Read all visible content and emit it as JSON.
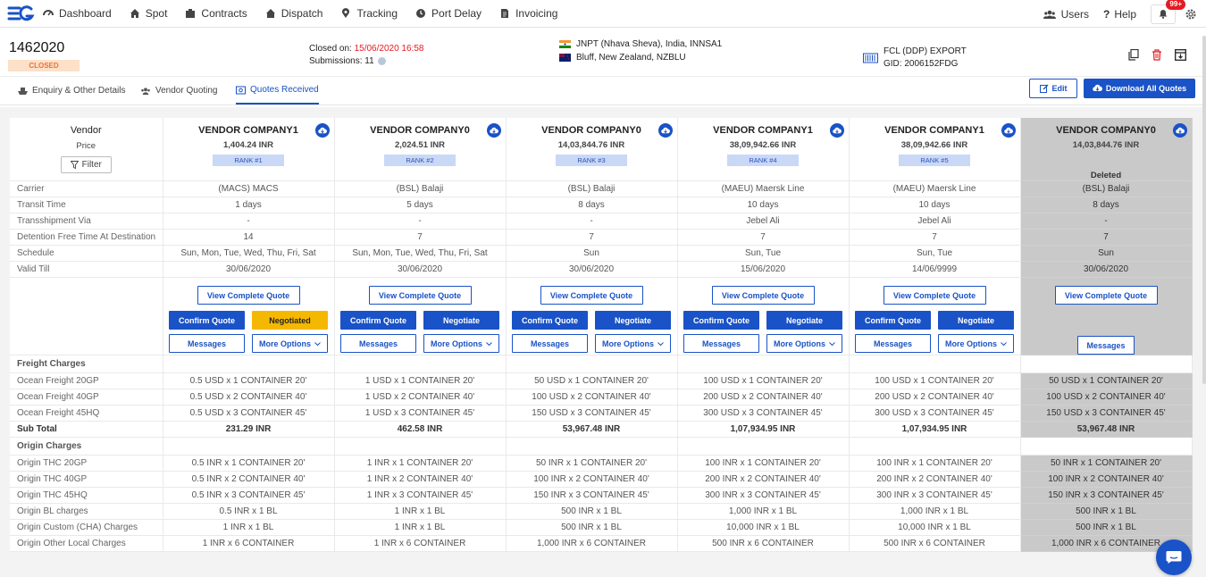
{
  "nav": {
    "items": [
      {
        "label": "Dashboard",
        "icon": "dashboard-icon"
      },
      {
        "label": "Spot",
        "icon": "spot-icon"
      },
      {
        "label": "Contracts",
        "icon": "contracts-icon"
      },
      {
        "label": "Dispatch",
        "icon": "dispatch-icon"
      },
      {
        "label": "Tracking",
        "icon": "tracking-icon"
      },
      {
        "label": "Port Delay",
        "icon": "clock-icon"
      },
      {
        "label": "Invoicing",
        "icon": "invoice-icon"
      }
    ],
    "users": "Users",
    "help": "Help",
    "notifications": "99+"
  },
  "header": {
    "id": "1462020",
    "status": "CLOSED",
    "closed_on_label": "Closed on:",
    "closed_on_value": "15/06/2020 16:58",
    "submissions": "Submissions: 11",
    "origin": "JNPT (Nhava Sheva), India, INNSA1",
    "destination": "Bluff, New Zealand, NZBLU",
    "load_type": "FCL (DDP) EXPORT",
    "gid": "GID: 2006152FDG"
  },
  "tabs": [
    "Enquiry & Other Details",
    "Vendor Quoting",
    "Quotes Received"
  ],
  "buttons": {
    "edit": "Edit",
    "download_all": "Download All Quotes",
    "filter": "Filter",
    "view_complete_quote": "View Complete Quote",
    "confirm_quote": "Confirm Quote",
    "negotiate": "Negotiate",
    "negotiated": "Negotiated",
    "messages": "Messages",
    "more_options": "More Options"
  },
  "table": {
    "vendor_label": "Vendor",
    "price_label": "Price",
    "deleted_label": "Deleted",
    "vendors": [
      {
        "name": "VENDOR COMPANY1",
        "price": "1,404.24 INR",
        "rank": "RANK #1"
      },
      {
        "name": "VENDOR COMPANY0",
        "price": "2,024.51 INR",
        "rank": "RANK #2"
      },
      {
        "name": "VENDOR COMPANY0",
        "price": "14,03,844.76 INR",
        "rank": "RANK #3"
      },
      {
        "name": "VENDOR COMPANY1",
        "price": "38,09,942.66 INR",
        "rank": "RANK #4"
      },
      {
        "name": "VENDOR COMPANY1",
        "price": "38,09,942.66 INR",
        "rank": "RANK #5"
      },
      {
        "name": "VENDOR COMPANY0",
        "price": "14,03,844.76 INR",
        "rank": ""
      }
    ],
    "info_rows": [
      {
        "label": "Carrier",
        "values": [
          "(MACS) MACS",
          "(BSL) Balaji",
          "(BSL) Balaji",
          "(MAEU) Maersk Line",
          "(MAEU) Maersk Line",
          "(BSL) Balaji"
        ]
      },
      {
        "label": "Transit Time",
        "values": [
          "1 days",
          "5 days",
          "8 days",
          "10 days",
          "10 days",
          "8 days"
        ]
      },
      {
        "label": "Transshipment Via",
        "values": [
          "-",
          "-",
          "-",
          "Jebel Ali",
          "Jebel Ali",
          "-"
        ]
      },
      {
        "label": "Detention Free Time At Destination",
        "values": [
          "14",
          "7",
          "7",
          "7",
          "7",
          "7"
        ]
      },
      {
        "label": "Schedule",
        "values": [
          "Sun, Mon, Tue, Wed, Thu, Fri, Sat",
          "Sun, Mon, Tue, Wed, Thu, Fri, Sat",
          "Sun",
          "Sun, Tue",
          "Sun, Tue",
          "Sun"
        ]
      },
      {
        "label": "Valid Till",
        "values": [
          "30/06/2020",
          "30/06/2020",
          "30/06/2020",
          "15/06/2020",
          "14/06/9999",
          "30/06/2020"
        ]
      }
    ],
    "freight_title": "Freight Charges",
    "freight_rows": [
      {
        "label": "Ocean Freight 20GP",
        "values": [
          "0.5 USD x 1 CONTAINER 20'",
          "1 USD x 1 CONTAINER 20'",
          "50 USD x 1 CONTAINER 20'",
          "100 USD x 1 CONTAINER 20'",
          "100 USD x 1 CONTAINER 20'",
          "50 USD x 1 CONTAINER 20'"
        ]
      },
      {
        "label": "Ocean Freight 40GP",
        "values": [
          "0.5 USD x 2 CONTAINER 40'",
          "1 USD x 2 CONTAINER 40'",
          "100 USD x 2 CONTAINER 40'",
          "200 USD x 2 CONTAINER 40'",
          "200 USD x 2 CONTAINER 40'",
          "100 USD x 2 CONTAINER 40'"
        ]
      },
      {
        "label": "Ocean Freight 45HQ",
        "values": [
          "0.5 USD x 3 CONTAINER 45'",
          "1 USD x 3 CONTAINER 45'",
          "150 USD x 3 CONTAINER 45'",
          "300 USD x 3 CONTAINER 45'",
          "300 USD x 3 CONTAINER 45'",
          "150 USD x 3 CONTAINER 45'"
        ]
      }
    ],
    "subtotal": {
      "label": "Sub Total",
      "values": [
        "231.29 INR",
        "462.58 INR",
        "53,967.48 INR",
        "1,07,934.95 INR",
        "1,07,934.95 INR",
        "53,967.48 INR"
      ]
    },
    "origin_title": "Origin Charges",
    "origin_rows": [
      {
        "label": "Origin THC 20GP",
        "values": [
          "0.5 INR x 1 CONTAINER 20'",
          "1 INR x 1 CONTAINER 20'",
          "50 INR x 1 CONTAINER 20'",
          "100 INR x 1 CONTAINER 20'",
          "100 INR x 1 CONTAINER 20'",
          "50 INR x 1 CONTAINER 20'"
        ]
      },
      {
        "label": "Origin THC 40GP",
        "values": [
          "0.5 INR x 2 CONTAINER 40'",
          "1 INR x 2 CONTAINER 40'",
          "100 INR x 2 CONTAINER 40'",
          "200 INR x 2 CONTAINER 40'",
          "200 INR x 2 CONTAINER 40'",
          "100 INR x 2 CONTAINER 40'"
        ]
      },
      {
        "label": "Origin THC 45HQ",
        "values": [
          "0.5 INR x 3 CONTAINER 45'",
          "1 INR x 3 CONTAINER 45'",
          "150 INR x 3 CONTAINER 45'",
          "300 INR x 3 CONTAINER 45'",
          "300 INR x 3 CONTAINER 45'",
          "150 INR x 3 CONTAINER 45'"
        ]
      },
      {
        "label": "Origin BL charges",
        "values": [
          "0.5 INR x 1 BL",
          "1 INR x 1 BL",
          "500 INR x 1 BL",
          "1,000 INR x 1 BL",
          "1,000 INR x 1 BL",
          "500 INR x 1 BL"
        ]
      },
      {
        "label": "Origin Custom (CHA) Charges",
        "values": [
          "1 INR x 1 BL",
          "1 INR x 1 BL",
          "500 INR x 1 BL",
          "10,000 INR x 1 BL",
          "10,000 INR x 1 BL",
          "500 INR x 1 BL"
        ]
      },
      {
        "label": "Origin Other Local Charges",
        "values": [
          "1 INR x 6 CONTAINER",
          "1 INR x 6 CONTAINER",
          "1,000 INR x 6 CONTAINER",
          "500 INR x 6 CONTAINER",
          "500 INR x 6 CONTAINER",
          "1,000 INR x 6 CONTAINER"
        ]
      }
    ]
  },
  "colors": {
    "primary": "#1a52c7",
    "danger": "#e31b23",
    "negotiated": "#f5b800",
    "deleted_column": "#c9c9c9"
  }
}
